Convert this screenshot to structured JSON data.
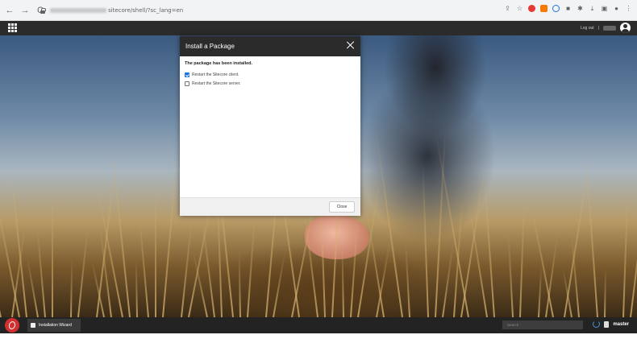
{
  "browser": {
    "url_path": "sitecore/shell/?sc_lang=en",
    "nav": {
      "back": "←",
      "forward": "→",
      "reload": "C"
    }
  },
  "topbar": {
    "logout_label": "Log out",
    "separator": "|"
  },
  "dialog": {
    "title": "Install a Package",
    "message": "The package has been installed.",
    "options": [
      {
        "label": "Restart the Sitecore client.",
        "checked": true
      },
      {
        "label": "Restart the Sitecore server.",
        "checked": false
      }
    ],
    "close_button": "Close"
  },
  "taskbar": {
    "task_label": "Installation Wizard",
    "search_placeholder": "Search",
    "database": "master"
  },
  "colors": {
    "topbar": "#2b2b2b",
    "start_button": "#d32f2f",
    "checkbox_checked": "#1a73e8"
  }
}
